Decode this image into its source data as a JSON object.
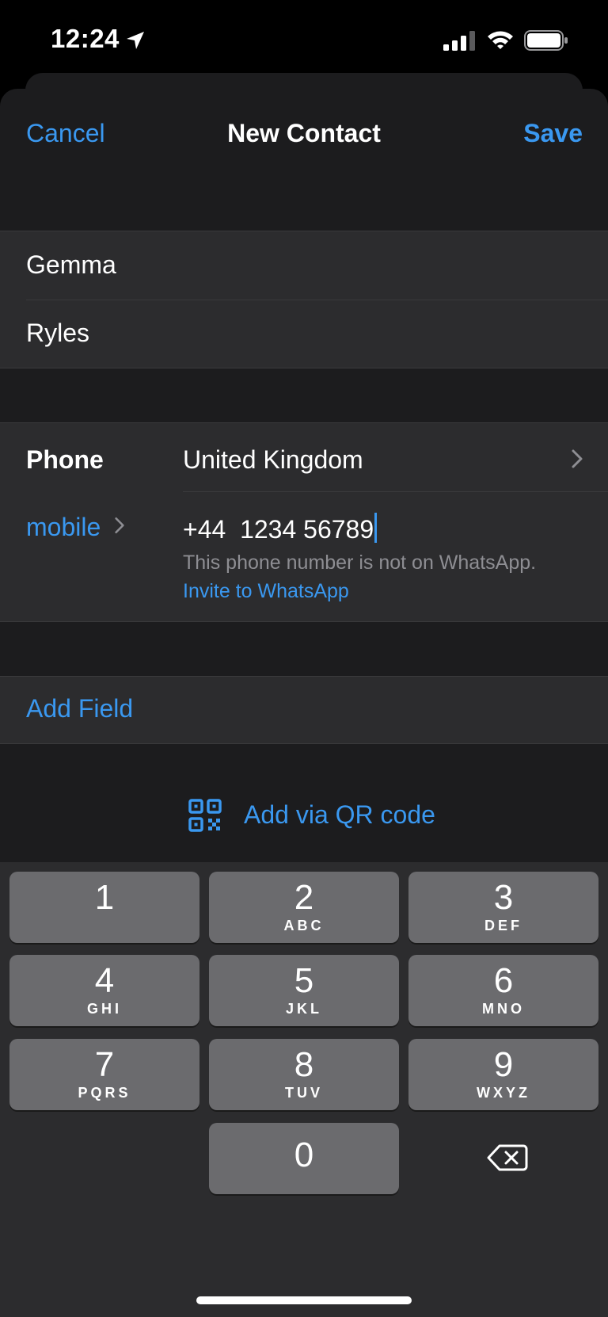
{
  "status_bar": {
    "time": "12:24",
    "icons": [
      "location-arrow-icon",
      "cellular-signal-icon",
      "wifi-icon",
      "battery-icon"
    ]
  },
  "nav": {
    "cancel": "Cancel",
    "title": "New Contact",
    "save": "Save"
  },
  "name_fields": {
    "first_name": "Gemma",
    "last_name": "Ryles"
  },
  "phone": {
    "section_label": "Phone",
    "country": "United Kingdom",
    "type_label": "mobile",
    "number": "+44  1234 56789",
    "status_note": "This phone number is not on WhatsApp.",
    "invite_link": "Invite to WhatsApp"
  },
  "add_field": "Add Field",
  "qr": {
    "label": "Add via QR code",
    "icon": "qr-code-icon"
  },
  "keypad": {
    "keys": [
      {
        "digit": "1",
        "letters": ""
      },
      {
        "digit": "2",
        "letters": "ABC"
      },
      {
        "digit": "3",
        "letters": "DEF"
      },
      {
        "digit": "4",
        "letters": "GHI"
      },
      {
        "digit": "5",
        "letters": "JKL"
      },
      {
        "digit": "6",
        "letters": "MNO"
      },
      {
        "digit": "7",
        "letters": "PQRS"
      },
      {
        "digit": "8",
        "letters": "TUV"
      },
      {
        "digit": "9",
        "letters": "WXYZ"
      },
      {
        "digit": "0",
        "letters": ""
      }
    ],
    "delete_icon": "delete-backspace-icon"
  },
  "colors": {
    "accent": "#3a98f0",
    "sheet_bg": "#1c1c1e",
    "group_bg": "#2c2c2e",
    "key_bg": "#6b6b6e",
    "secondary_text": "#8e8e93"
  }
}
